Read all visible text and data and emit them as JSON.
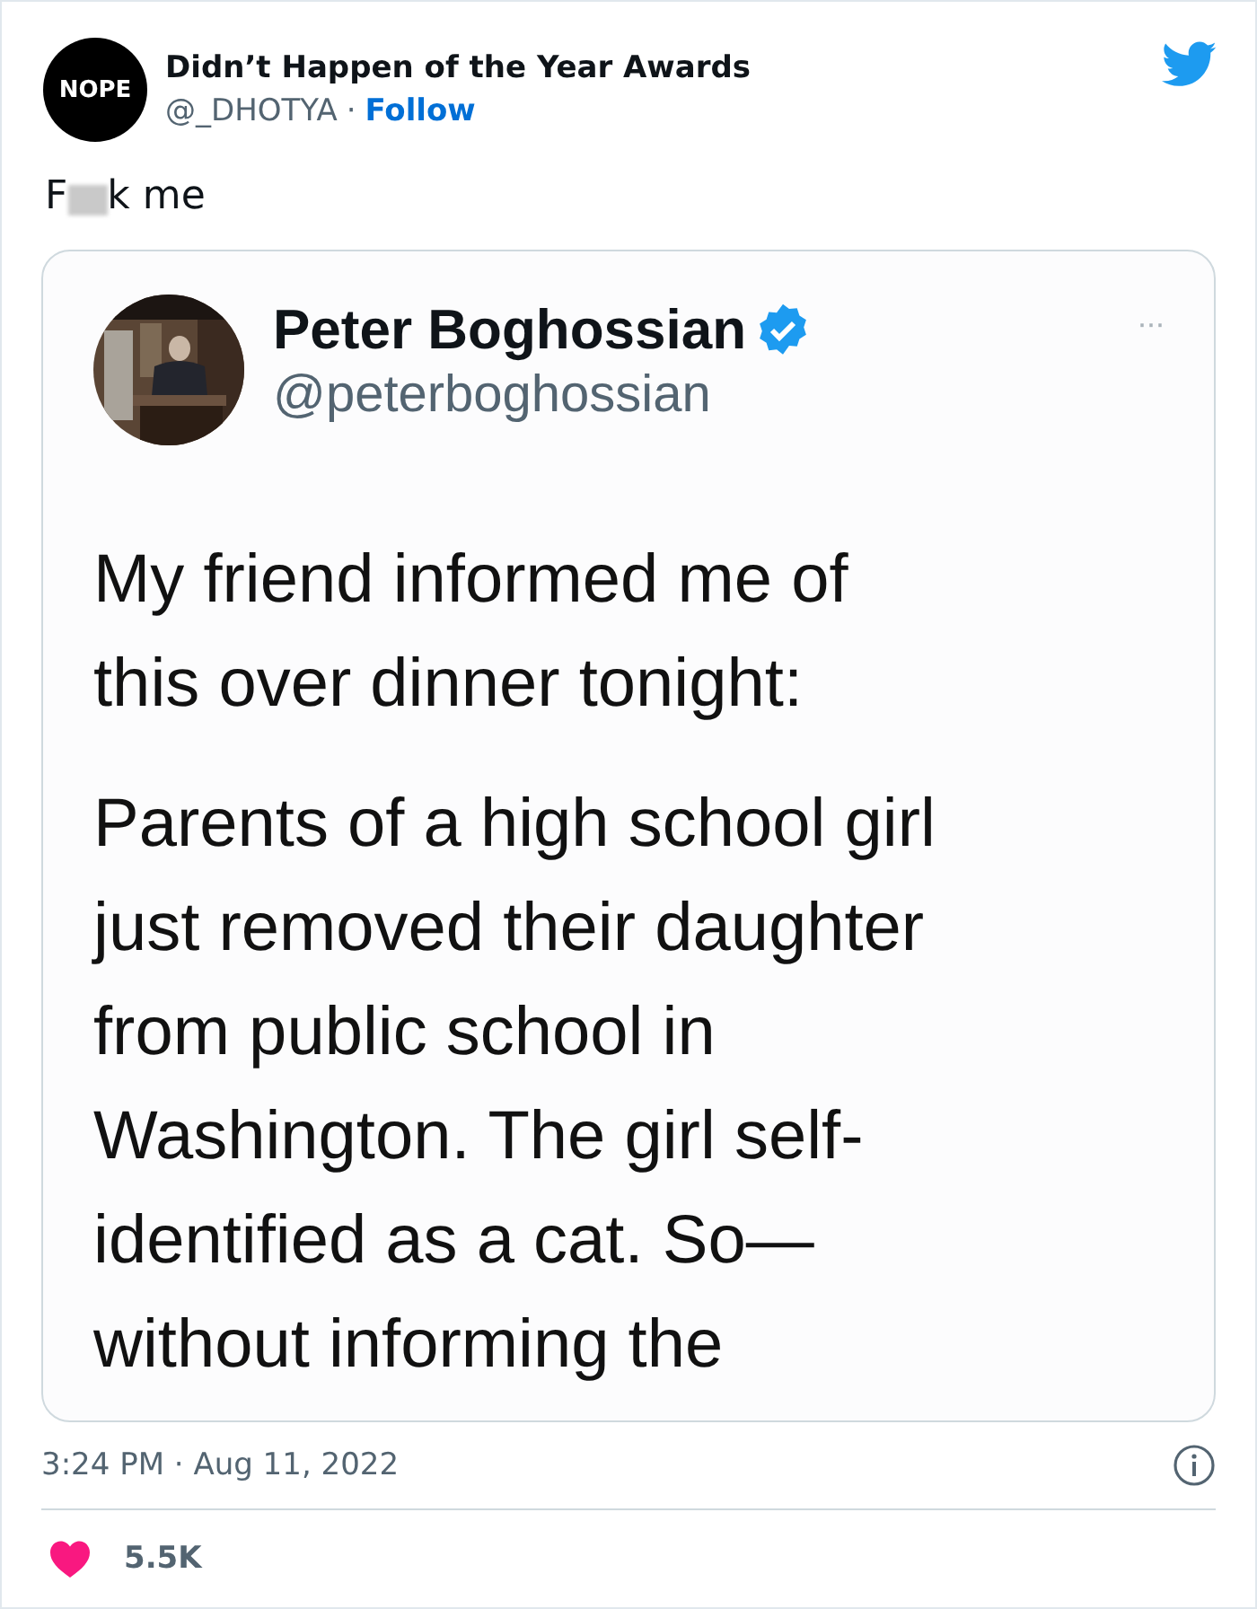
{
  "author": {
    "avatar_text": "NOPE",
    "name": "Didn’t Happen of the Year Awards",
    "handle": "@_DHOTYA",
    "separator": "·",
    "follow": "Follow"
  },
  "tweet_text": {
    "before_censor": "F",
    "after_censor": "k me"
  },
  "quoted": {
    "kind": "picture",
    "name": "Peter Boghossian",
    "verified": true,
    "handle": "@peterboghossian",
    "more": "···",
    "paragraphs": [
      [
        "My friend informed me of",
        "this over dinner tonight:"
      ],
      [
        "Parents of a high school girl",
        "just removed their daughter",
        "from public school in",
        "Washington. The girl self-",
        "identified as a cat. So—",
        "without informing the"
      ]
    ]
  },
  "timestamp": "3:24 PM · Aug 11, 2022",
  "likes": "5.5K"
}
